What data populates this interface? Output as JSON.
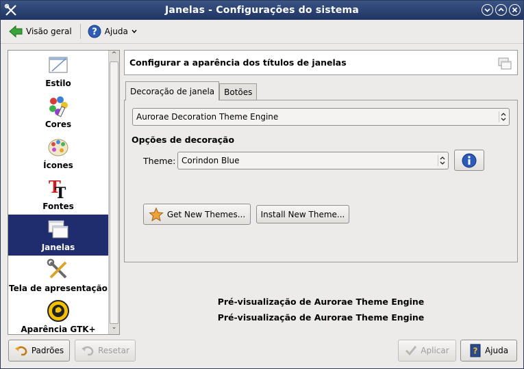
{
  "window": {
    "title": "Janelas - Configurações do sistema"
  },
  "toolbar": {
    "overview_label": "Visão geral",
    "help_label": "Ajuda"
  },
  "sidebar": {
    "items": [
      {
        "label": "Estilo",
        "icon": "style-icon"
      },
      {
        "label": "Cores",
        "icon": "colors-icon"
      },
      {
        "label": "Ícones",
        "icon": "icons-icon"
      },
      {
        "label": "Fontes",
        "icon": "fonts-icon"
      },
      {
        "label": "Janelas",
        "icon": "windows-icon",
        "selected": true
      },
      {
        "label": "Tela de apresentação",
        "icon": "splash-icon"
      },
      {
        "label": "Aparência GTK+",
        "icon": "gtk-icon"
      }
    ]
  },
  "main": {
    "header": "Configurar a aparência dos títulos de janelas",
    "tabs": [
      {
        "label": "Decoração de janela",
        "active": true
      },
      {
        "label": "Botões",
        "active": false
      }
    ],
    "engine_select": "Aurorae Decoration Theme Engine",
    "section_title": "Opções de decoração",
    "theme_label": "Theme:",
    "theme_select": "Corindon Blue",
    "get_themes_label": "Get New Themes...",
    "install_theme_label": "Install New Theme...",
    "preview_lines": [
      "Pré-visualização de Aurorae Theme Engine",
      "Pré-visualização de Aurorae Theme Engine"
    ]
  },
  "footer": {
    "defaults_label": "Padrões",
    "reset_label": "Resetar",
    "apply_label": "Aplicar",
    "help_label": "Ajuda"
  },
  "colors": {
    "titlebar": "#2b4375",
    "selection": "#1f2c6d",
    "window_bg": "#ecebe9"
  }
}
